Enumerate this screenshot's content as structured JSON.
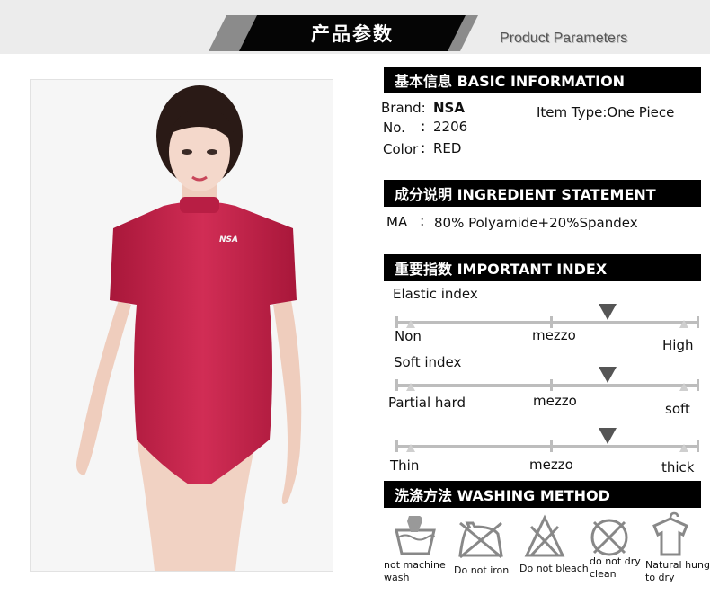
{
  "banner": {
    "title_cn": "产品参数",
    "title_en": "Product Parameters"
  },
  "product_photo": {
    "logo_text": "NSA",
    "garment_color": "#c7244b"
  },
  "basic": {
    "header": "基本信息 BASIC INFORMATION",
    "brand_label": "Brand:",
    "brand_value": "NSA",
    "no_label": "No.",
    "no_value": "2206",
    "color_label": "Color",
    "color_value": "RED",
    "item_type": "Item Type:One Piece"
  },
  "ingredient": {
    "header": "成分说明 INGREDIENT STATEMENT",
    "ma_label": "MA",
    "ma_value": "80% Polyamide+20%Spandex"
  },
  "index": {
    "header": "重要指数 IMPORTANT INDEX",
    "scales": [
      {
        "title": "Elastic index",
        "low": "Non",
        "mid": "mezzo",
        "high": "High",
        "level": 0.72
      },
      {
        "title": "Soft index",
        "low": "Partial hard",
        "mid": "mezzo",
        "high": "soft",
        "level": 0.72
      },
      {
        "title": "",
        "low": "Thin",
        "mid": "mezzo",
        "high": "thick",
        "level": 0.72
      }
    ]
  },
  "washing": {
    "header": "洗涤方法 WASHING METHOD",
    "items": [
      {
        "icon": "hand-wash-icon",
        "label": "not machine wash"
      },
      {
        "icon": "no-iron-icon",
        "label": "Do not iron"
      },
      {
        "icon": "no-bleach-icon",
        "label": "Do not bleach"
      },
      {
        "icon": "no-dry-clean-icon",
        "label": "do not dry clean"
      },
      {
        "icon": "hang-dry-icon",
        "label": "Natural hung to dry"
      }
    ]
  },
  "colors": {
    "header_bg": "#000000",
    "scale_track": "#bdbdbd",
    "marker": "#555555"
  }
}
